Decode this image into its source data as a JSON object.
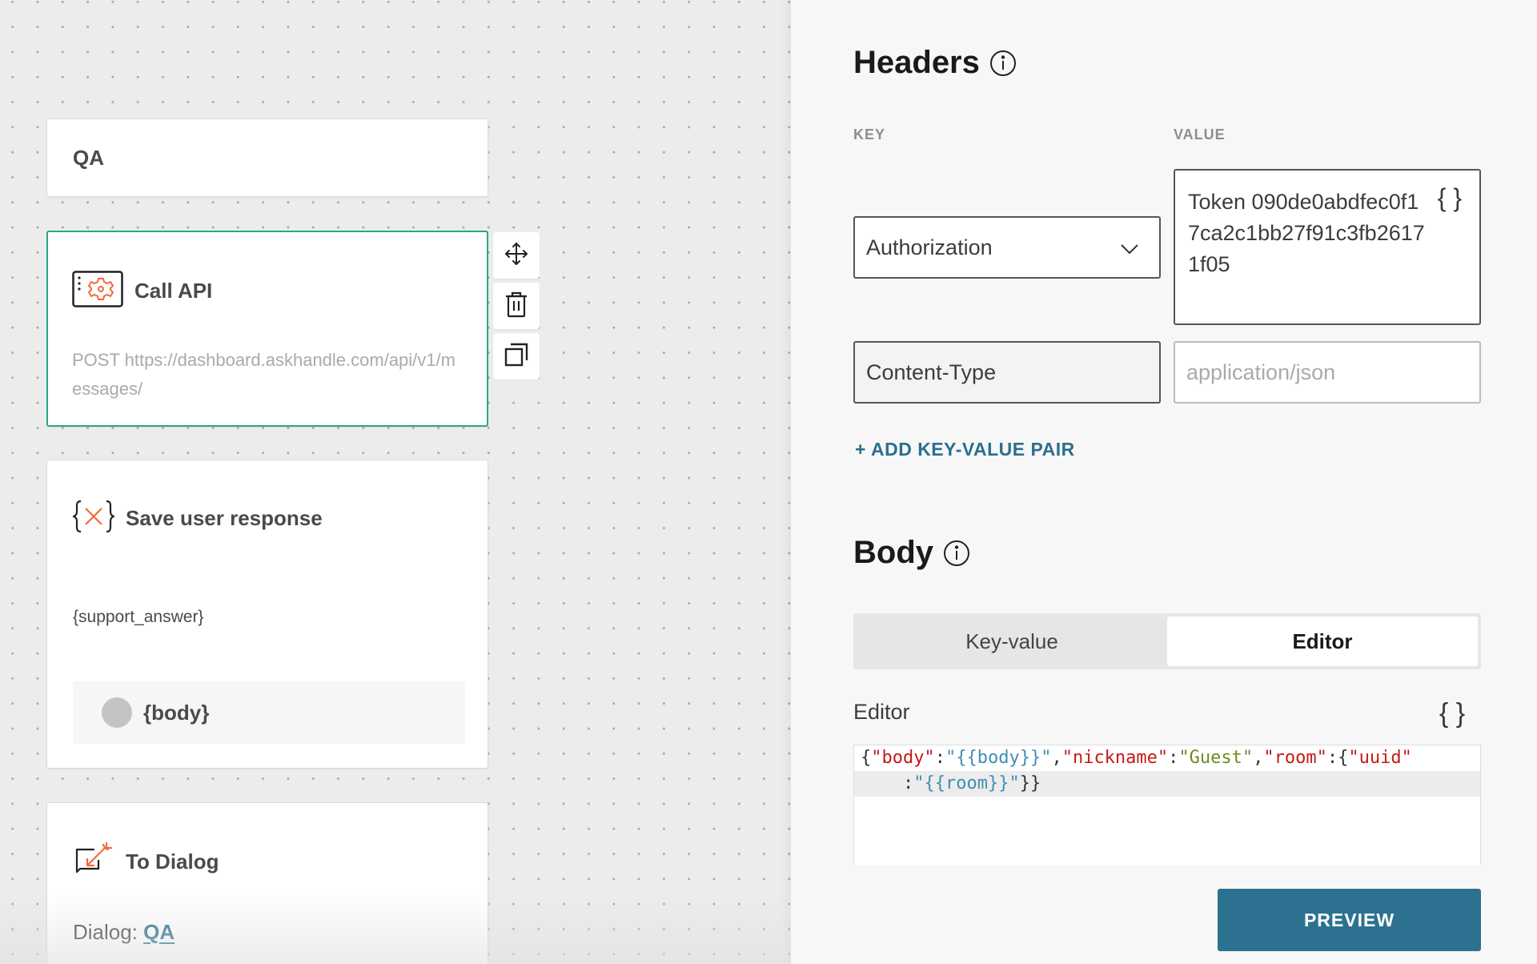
{
  "canvas": {
    "nodes": {
      "qa": {
        "title": "QA"
      },
      "call_api": {
        "title": "Call API",
        "description": "POST https://dashboard.askhandle.com/api/v1/messages/",
        "icon": "api-gear-icon"
      },
      "save_response": {
        "title": "Save user response",
        "variable": "{support_answer}",
        "chip_label": "{body}",
        "icon": "variable-braces-icon"
      },
      "to_dialog": {
        "title": "To Dialog",
        "dialog_label": "Dialog:",
        "dialog_link": "QA",
        "icon": "dialog-arrow-icon"
      }
    },
    "node_actions": [
      {
        "name": "move",
        "icon": "move-arrows-icon"
      },
      {
        "name": "delete",
        "icon": "trash-icon"
      },
      {
        "name": "duplicate",
        "icon": "copy-icon"
      }
    ]
  },
  "panel": {
    "headers": {
      "title": "Headers",
      "key_label": "KEY",
      "value_label": "VALUE",
      "rows": [
        {
          "key": "Authorization",
          "value": "Token 090de0abdfec0f17ca2c1bb27f91c3fb26171f05"
        },
        {
          "key": "Content-Type",
          "value_placeholder": "application/json"
        }
      ],
      "add_pair_label": "+ ADD KEY-VALUE PAIR"
    },
    "body": {
      "title": "Body",
      "tabs": [
        {
          "label": "Key-value",
          "active": false
        },
        {
          "label": "Editor",
          "active": true
        }
      ],
      "editor_label": "Editor",
      "editor_content": "{\"body\":\"{{body}}\",\"nickname\":\"Guest\",\"room\":{\"uuid\":\"{{room}}\"}}",
      "editor_tokens": {
        "open": "{",
        "k1": "\"body\"",
        "c1": ":",
        "v1a": "\"",
        "v1b": "{{body}}",
        "v1c": "\"",
        "comma1": ",",
        "k2": "\"nickname\"",
        "c2": ":",
        "v2": "\"Guest\"",
        "comma2": ",",
        "k3": "\"room\"",
        "c3": ":{",
        "k4": "\"uuid\"",
        "c4": "    :",
        "v4a": "\"",
        "v4b": "{{room}}",
        "v4c": "\"",
        "close": "}}"
      }
    },
    "preview_label": "PREVIEW"
  },
  "colors": {
    "accent": "#2c7290",
    "selected_border": "#2aa58e",
    "icon_orange": "#f26b3a"
  }
}
